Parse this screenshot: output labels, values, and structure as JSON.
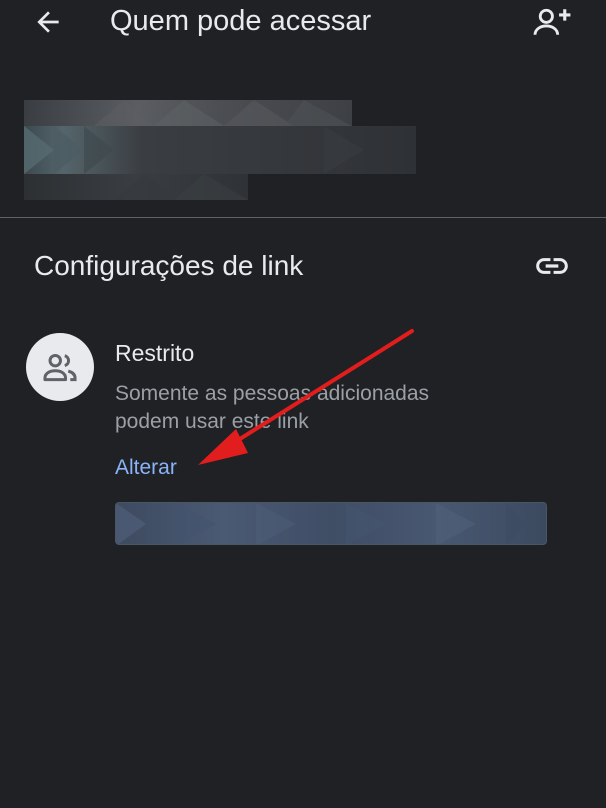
{
  "header": {
    "title": "Quem pode acessar",
    "back_icon": "arrow-left-icon",
    "add_person_icon": "person-add-icon"
  },
  "link_settings": {
    "title": "Configurações de link",
    "link_icon": "link-icon"
  },
  "access": {
    "avatar_icon": "people-icon",
    "title": "Restrito",
    "description": "Somente as pessoas adicionadas podem usar este link",
    "change_label": "Alterar"
  },
  "colors": {
    "background": "#202124",
    "text_primary": "#e8eaed",
    "text_secondary": "#9aa0a6",
    "link": "#8ab4f8",
    "divider": "#5f6368",
    "annotation_arrow": "#e11d1d"
  }
}
